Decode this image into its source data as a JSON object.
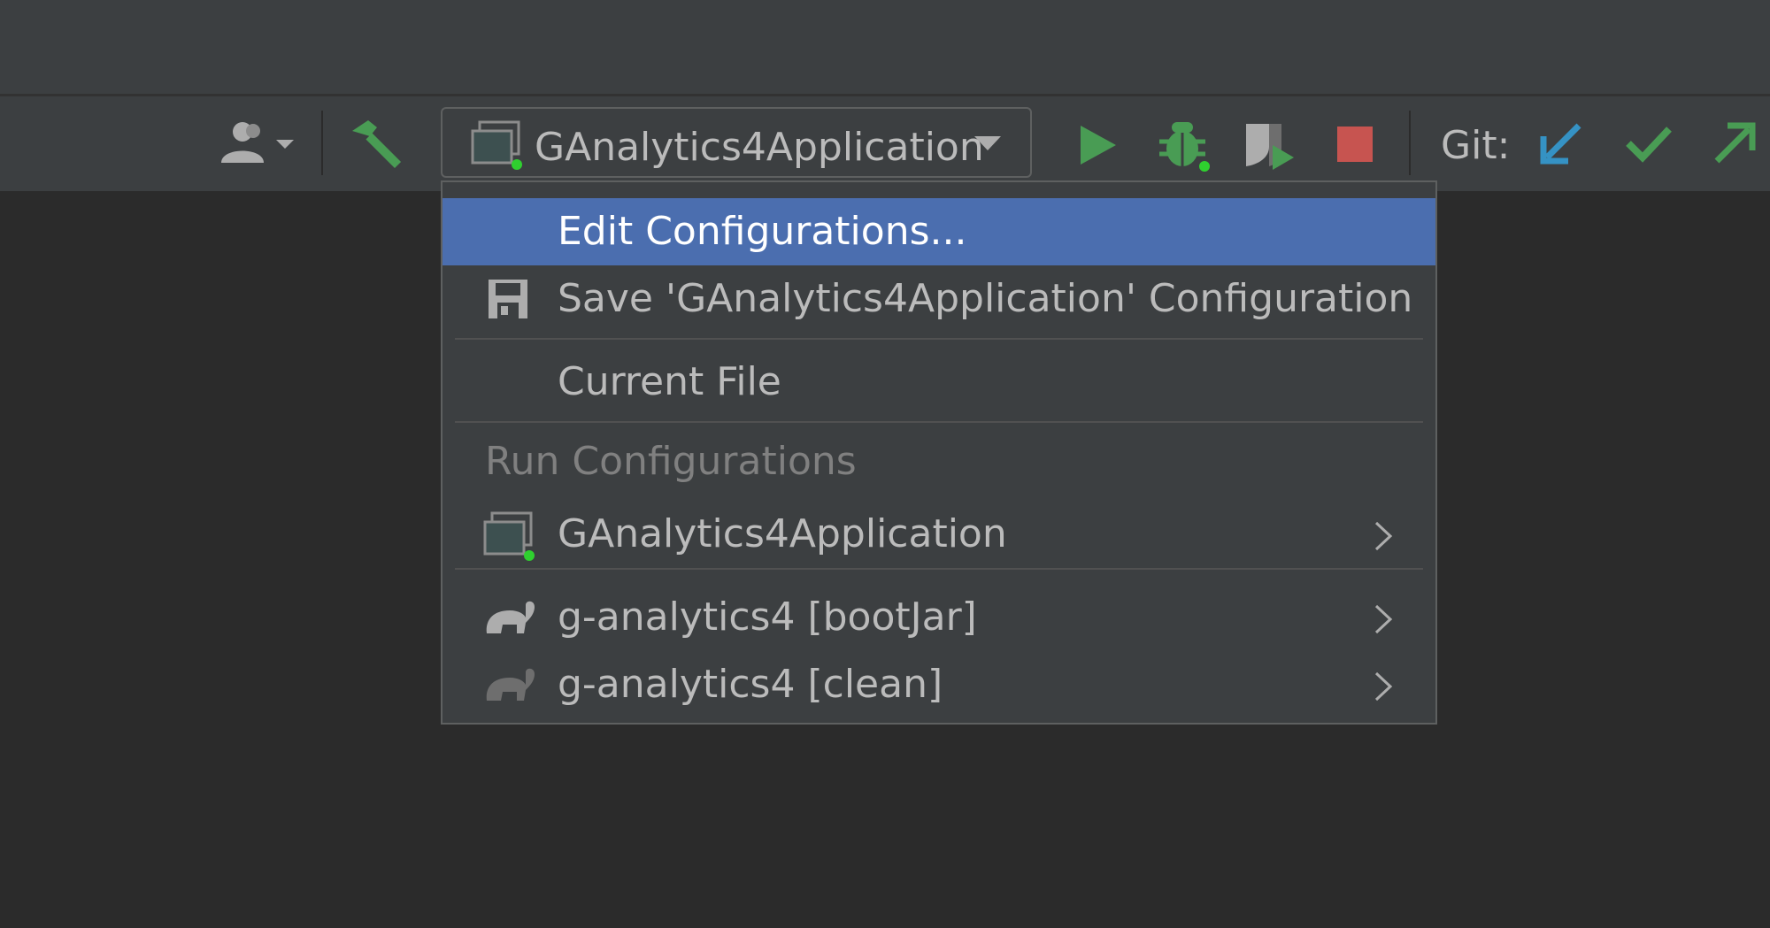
{
  "toolbar": {
    "user_icon": "user-switch-icon",
    "build_icon": "hammer-icon",
    "run_config": {
      "label": "GAnalytics4Application",
      "icon": "application-config-icon"
    },
    "run_icon": "run-icon",
    "debug_icon": "debug-icon",
    "coverage_icon": "coverage-icon",
    "stop_icon": "stop-icon",
    "git_label": "Git:",
    "git_update_icon": "git-update-icon",
    "git_commit_icon": "git-commit-icon",
    "git_push_icon": "git-push-icon"
  },
  "popup": {
    "items": [
      {
        "label": "Edit Configurations...",
        "selected": true
      },
      {
        "label": "Save 'GAnalytics4Application' Configuration",
        "icon": "save-icon"
      },
      {
        "label": "Current File"
      }
    ],
    "group_header": "Run Configurations",
    "configurations": [
      {
        "label": "GAnalytics4Application",
        "icon": "application-config-icon"
      },
      {
        "label": "g-analytics4 [bootJar]",
        "icon": "gradle-icon"
      },
      {
        "label": "g-analytics4 [clean]",
        "icon": "gradle-icon"
      }
    ]
  },
  "colors": {
    "selection": "#4b6eaf",
    "run_green": "#499c54",
    "stop_red": "#c75450",
    "git_update_blue": "#3592c4"
  }
}
